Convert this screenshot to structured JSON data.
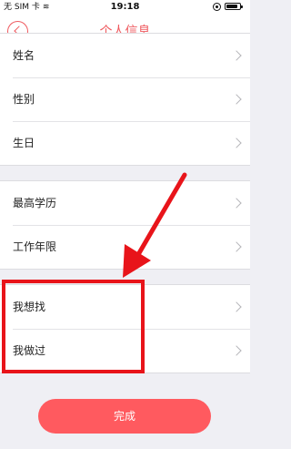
{
  "status_bar": {
    "carrier": "无 SIM 卡",
    "time": "19:18",
    "battery_level": 0.85
  },
  "nav": {
    "title": "个人信息"
  },
  "groups": [
    {
      "items": [
        {
          "label": "姓名"
        },
        {
          "label": "性别"
        },
        {
          "label": "生日"
        }
      ]
    },
    {
      "items": [
        {
          "label": "最高学历"
        },
        {
          "label": "工作年限"
        }
      ]
    },
    {
      "items": [
        {
          "label": "我想找"
        },
        {
          "label": "我做过"
        }
      ]
    }
  ],
  "done_button": {
    "label": "完成"
  },
  "colors": {
    "accent": "#ff5a5f",
    "annotation": "#e8141a"
  }
}
